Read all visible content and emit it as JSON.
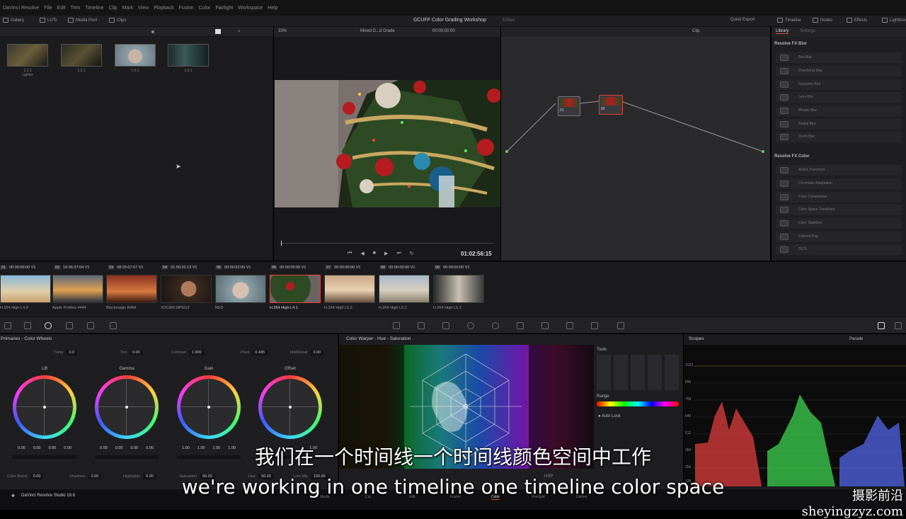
{
  "menu": [
    "DaVinci Resolve",
    "File",
    "Edit",
    "Trim",
    "Timeline",
    "Clip",
    "Mark",
    "View",
    "Playback",
    "Fusion",
    "Color",
    "Fairlight",
    "Workspace",
    "Help"
  ],
  "toolbar": {
    "gallery": "Gallery",
    "luts": "LUTs",
    "media_pool": "Media Pool",
    "clips": "Clips",
    "project_title": "GCUFF Color Grading Workshop",
    "project_status": "Edited",
    "quick_export": "Quick Export",
    "timeline": "Timeline",
    "nodes": "Nodes",
    "effects": "Effects",
    "lightbox": "Lightbox"
  },
  "viewer": {
    "zoom": "33%",
    "timeline_name": "Mixed D...d Grade",
    "timecode_top": "00:00:00:00",
    "timecode": "01:02:56:15"
  },
  "node_editor": {
    "mode": "Clip",
    "node_labels": [
      "01",
      "02"
    ]
  },
  "gallery_stills": [
    {
      "label": "1.1.1",
      "sub": "Lighter"
    },
    {
      "label": "1.2.1",
      "sub": ""
    },
    {
      "label": "1.5.1",
      "sub": ""
    },
    {
      "label": "1.6.1",
      "sub": ""
    }
  ],
  "library": {
    "tab_library": "Library",
    "tab_settings": "Settings",
    "blur_header": "Resolve FX Blur",
    "blur_items": [
      "Box Blur",
      "Directional Blur",
      "Gaussian Blur",
      "Lens Blur",
      "Mosaic Blur",
      "Radial Blur",
      "Zoom Blur"
    ],
    "color_header": "Resolve FX Color",
    "color_items": [
      "ACES Transform",
      "Chromatic Adaptation",
      "Color Compressor",
      "Color Space Transform",
      "Color Stabilizer",
      "Colored Pop",
      "DCTL"
    ]
  },
  "clips": [
    {
      "num": "01",
      "tc": "00:00:00:00",
      "track": "V1",
      "codec": "H.264 High L4.0"
    },
    {
      "num": "02",
      "tc": "16:06:37:04",
      "track": "V1",
      "codec": "Apple ProRes 4444"
    },
    {
      "num": "03",
      "tc": "08:25:07:07",
      "track": "V1",
      "codec": "Blackmagic RAW"
    },
    {
      "num": "04",
      "tc": "01:50:32:13",
      "track": "V1",
      "codec": "XDCAM MPEG2"
    },
    {
      "num": "05",
      "tc": "00:00:52:05",
      "track": "V1",
      "codec": "RED"
    },
    {
      "num": "06",
      "tc": "00:00:00:00",
      "track": "V1",
      "codec": "H.264 High L4.1"
    },
    {
      "num": "07",
      "tc": "00:00:00:00",
      "track": "V1",
      "codec": "H.264 High L5.2"
    },
    {
      "num": "08",
      "tc": "00:00:00:00",
      "track": "V1",
      "codec": "H.264 High L5.2"
    },
    {
      "num": "09",
      "tc": "00:00:00:00",
      "track": "V1",
      "codec": "H.264 High L5.2"
    }
  ],
  "primaries": {
    "title": "Primaries - Color Wheels",
    "temp_label": "Temp",
    "temp": "0.0",
    "tint_label": "Tint",
    "tint": "0.00",
    "contrast_label": "Contrast",
    "contrast": "1.000",
    "pivot_label": "Pivot",
    "pivot": "0.435",
    "middetail_label": "Mid/Detail",
    "middetail": "0.00",
    "wheels": [
      {
        "name": "Lift",
        "values": [
          "0.00",
          "0.00",
          "0.00",
          "0.00"
        ]
      },
      {
        "name": "Gamma",
        "values": [
          "0.00",
          "0.00",
          "0.00",
          "0.00"
        ]
      },
      {
        "name": "Gain",
        "values": [
          "1.00",
          "1.00",
          "1.00",
          "1.00"
        ]
      },
      {
        "name": "Offset",
        "values": [
          "",
          "",
          "",
          "1.00"
        ]
      }
    ],
    "colorboost_label": "Color Boost",
    "colorboost": "0.00",
    "shadows_label": "Shadows",
    "shadows": "0.00",
    "highlights_label": "Highlights",
    "highlights": "0.00",
    "saturation_label": "Saturation",
    "saturation": "50.00",
    "hue_label": "Hue",
    "hue": "50.00",
    "lummix_label": "Lum Mix",
    "lummix": "100.00"
  },
  "warper": {
    "title": "Color Warper - Hue - Saturation",
    "tools_label": "Tools",
    "range_label": "Range",
    "autolock_label": "Auto Lock",
    "hsp_label": "HSP"
  },
  "scopes": {
    "title": "Scopes",
    "mode": "Parade",
    "ticks": [
      "1023",
      "896",
      "768",
      "640",
      "512",
      "384",
      "256",
      "128"
    ]
  },
  "bottom": {
    "app_name": "DaVinci Resolve Studio 18.6",
    "pages": [
      "Media",
      "Cut",
      "Edit",
      "Fusion",
      "Color",
      "Fairlight",
      "Deliver"
    ],
    "active_page": "Color"
  },
  "subtitles": {
    "cn": "我们在一个时间线一个时间线颜色空间中工作",
    "en": "we're working in one timeline one timeline color space"
  },
  "watermark": "摄影前沿 sheyingzyz.com",
  "colors": {
    "accent": "#e0413c",
    "panel": "#1e1e21",
    "bg": "#000000"
  }
}
